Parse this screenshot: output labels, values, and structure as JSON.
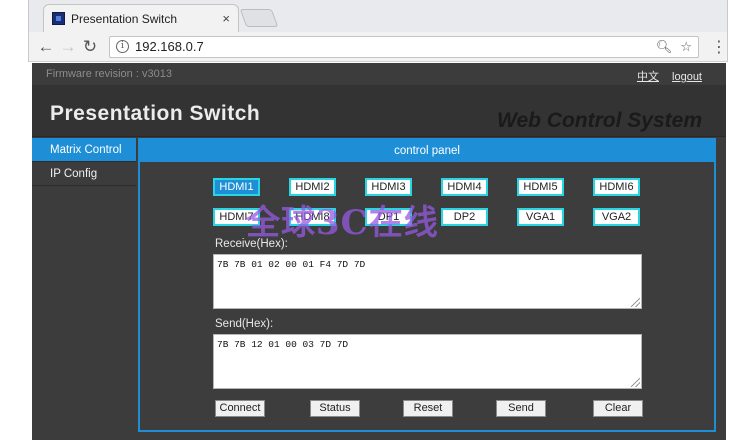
{
  "browser": {
    "tab_title": "Presentation Switch",
    "tab_close": "×",
    "url": "192.168.0.7",
    "icons": [
      "back-arrow-icon",
      "forward-arrow-icon",
      "reload-icon",
      "info-icon",
      "zoom-icon",
      "star-icon",
      "menu-icon"
    ]
  },
  "page": {
    "firmware": "Firmware revision : v3013",
    "lang_link": "中文",
    "logout_link": "logout",
    "brand": "Presentation Switch",
    "web_control": "Web Control System"
  },
  "sidebar": {
    "items": [
      {
        "label": "Matrix Control",
        "active": true
      },
      {
        "label": "IP Config",
        "active": false
      }
    ]
  },
  "panel": {
    "title": "control panel",
    "row1": [
      "HDMI1",
      "HDMI2",
      "HDMI3",
      "HDMI4",
      "HDMI5",
      "HDMI6"
    ],
    "row2": [
      "HDMI7",
      "HDMI8",
      "DP1",
      "DP2",
      "VGA1",
      "VGA2"
    ],
    "selected": "HDMI1",
    "receive_label": "Receive(Hex):",
    "receive_value": "7B 7B 01 02 00 01 F4 7D 7D",
    "send_label": "Send(Hex):",
    "send_value": "7B 7B 12 01 00 03 7D 7D",
    "actions": {
      "connect": "Connect",
      "status": "Status",
      "reset": "Reset",
      "send": "Send",
      "clear": "Clear"
    }
  },
  "watermark": "全球3C在线",
  "colors": {
    "accent": "#1e8fd6",
    "button_border": "#27d5e3",
    "page_bg": "#3c3c3c"
  }
}
